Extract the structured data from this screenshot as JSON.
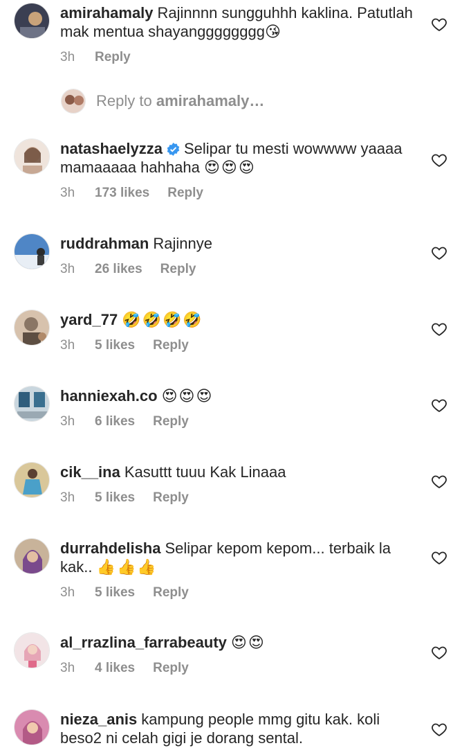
{
  "reply_bar": {
    "prefix": "Reply to",
    "target": "amirahamaly…"
  },
  "comments": [
    {
      "username": "amirahamaly",
      "verified": false,
      "text": "Rajinnnn sungguhhh kaklina. Patutlah mak mentua shayangggggggg😘",
      "emojis": "",
      "time": "3h",
      "likes": "",
      "reply": "Reply",
      "avatar_colors": [
        "#3b3f52",
        "#c9a37a"
      ]
    },
    {
      "username": "natashaelyzza",
      "verified": true,
      "text": "Selipar tu mesti wowwww yaaaa mamaaaaa hahhaha",
      "emojis": "😍😍😍",
      "time": "3h",
      "likes": "173 likes",
      "reply": "Reply",
      "avatar_colors": [
        "#d9b9a4",
        "#6b4b3a"
      ]
    },
    {
      "username": "ruddrahman",
      "verified": false,
      "text": "Rajinnye",
      "emojis": "",
      "time": "3h",
      "likes": "26 likes",
      "reply": "Reply",
      "avatar_colors": [
        "#4f86c6",
        "#e8eef5"
      ]
    },
    {
      "username": "yard_77",
      "verified": false,
      "text": "",
      "emojis": "🤣🤣🤣🤣",
      "time": "3h",
      "likes": "5 likes",
      "reply": "Reply",
      "avatar_colors": [
        "#8a7665",
        "#d7c2ad"
      ]
    },
    {
      "username": "hanniexah.co",
      "verified": false,
      "text": "",
      "emojis": "😍😍😍",
      "time": "3h",
      "likes": "6 likes",
      "reply": "Reply",
      "avatar_colors": [
        "#2f5d7c",
        "#c9d6de"
      ]
    },
    {
      "username": "cik__ina",
      "verified": false,
      "text": "Kasuttt tuuu Kak Linaaa",
      "emojis": "",
      "time": "3h",
      "likes": "5 likes",
      "reply": "Reply",
      "avatar_colors": [
        "#d9c79a",
        "#4aa0c9"
      ]
    },
    {
      "username": "durrahdelisha",
      "verified": false,
      "text": "Selipar kepom kepom... terbaik la kak..",
      "emojis": "👍👍👍",
      "time": "3h",
      "likes": "5 likes",
      "reply": "Reply",
      "avatar_colors": [
        "#c8b39a",
        "#7a4a8c"
      ]
    },
    {
      "username": "al_rrazlina_farrabeauty",
      "verified": false,
      "text": "",
      "emojis": "😍😍",
      "time": "3h",
      "likes": "4 likes",
      "reply": "Reply",
      "avatar_colors": [
        "#f2e4e6",
        "#e6a6b6"
      ]
    },
    {
      "username": "nieza_anis",
      "verified": false,
      "text": "kampung people mmg gitu kak. koli beso2 ni celah gigi je dorang sental.",
      "emojis": "",
      "time": "",
      "likes": "",
      "reply": "",
      "avatar_colors": [
        "#d98bb0",
        "#b35a86"
      ]
    }
  ]
}
